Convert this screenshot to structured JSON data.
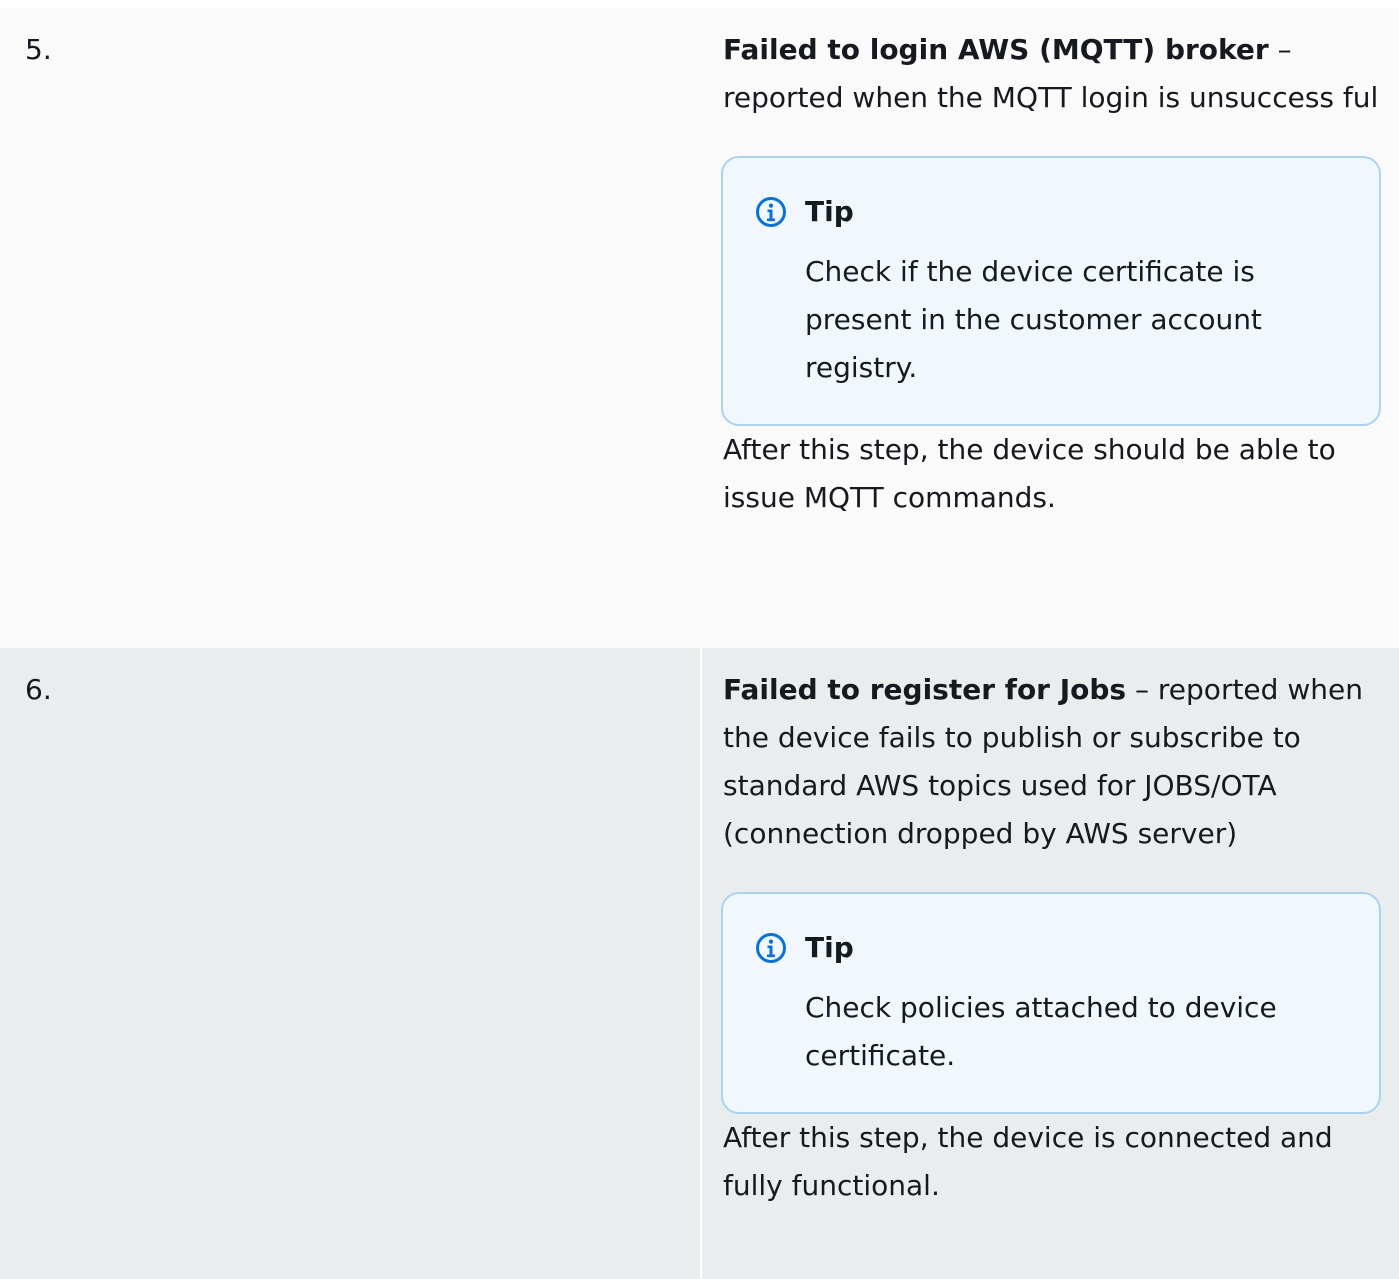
{
  "rows": [
    {
      "number": "5.",
      "term": "Failed to login AWS (MQTT) broker",
      "description": " – reported when the MQTT login is unsuccess ful",
      "tip": {
        "title": "Tip",
        "icon": "info-icon",
        "text": "Check if the device certificate is present in the customer account registry."
      },
      "after": "After this step, the device should be able to issue MQTT commands."
    },
    {
      "number": "6.",
      "term": "Failed to register for Jobs",
      "description": " – reported when the device fails to publish or subscribe to standard AWS topics used for JOBS/OTA (connection dropped by AWS server)",
      "tip": {
        "title": "Tip",
        "icon": "info-icon",
        "text": "Check policies attached to device certificate."
      },
      "after": "After this step, the device is connected and fully functional."
    }
  ],
  "colors": {
    "row_odd": "#fafafa",
    "row_even": "#eaeded",
    "tip_border": "#abd2ef",
    "tip_background": "#f1f8fd",
    "icon": "#0972d3"
  }
}
